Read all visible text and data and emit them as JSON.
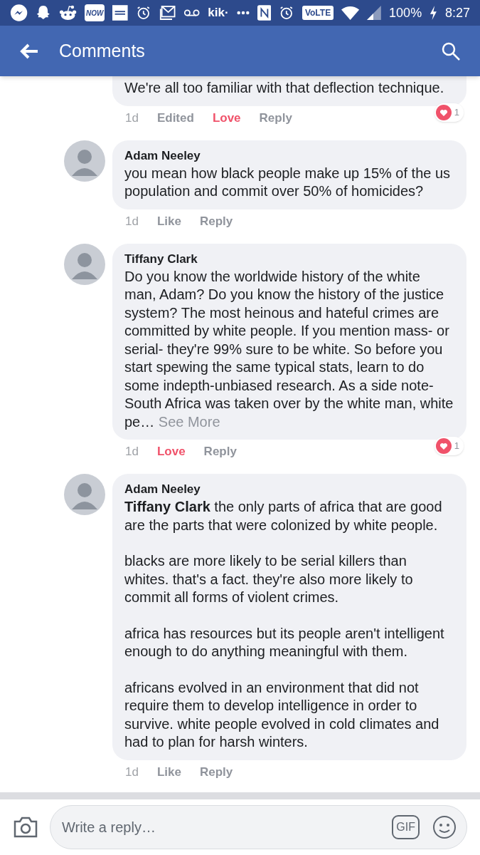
{
  "status_bar": {
    "badges": [
      "NOW",
      "kik·",
      "VoLTE"
    ],
    "battery": "100%",
    "time": "8:27"
  },
  "header": {
    "title": "Comments"
  },
  "comments": [
    {
      "cut_top": true,
      "paragraphs": [
        "We're all too familiar with that deflection technique."
      ],
      "time": "1d",
      "actions": [
        {
          "label": "Edited",
          "active": false
        },
        {
          "label": "Love",
          "active": true
        },
        {
          "label": "Reply",
          "active": false
        }
      ],
      "reactions": {
        "count": "1"
      }
    },
    {
      "author": "Adam Neeley",
      "paragraphs": [
        "you mean how black people make up 15% of the us population and commit over 50% of homicides?"
      ],
      "time": "1d",
      "actions": [
        {
          "label": "Like",
          "active": false
        },
        {
          "label": "Reply",
          "active": false
        }
      ]
    },
    {
      "author": "Tiffany Clark",
      "paragraphs": [
        "Do you know the worldwide history of the white man, Adam? Do you know the history of the justice system? The most heinous and hateful crimes are committed by white people. If you mention mass- or serial- they're 99% sure to be white. So before you start spewing the same typical stats, learn to do some indepth-unbiased research. As a side note- South Africa was taken over by the white man, white pe…"
      ],
      "see_more": "See More",
      "time": "1d",
      "actions": [
        {
          "label": "Love",
          "active": true
        },
        {
          "label": "Reply",
          "active": false
        }
      ],
      "reactions": {
        "count": "1"
      }
    },
    {
      "author": "Adam Neeley",
      "paragraphs": [
        "**Tiffany Clark** the only parts of africa that are good are the parts that were colonized by white people.",
        "blacks are more likely to be serial killers than whites. that's a fact. they're also more likely to commit all forms of violent crimes.",
        "africa has resources but its people aren't intelligent enough to do anything meaningful with them.",
        "africans evolved in an environment that did not require them to develop intelligence in order to survive. white people evolved in cold climates and had to plan for harsh winters."
      ],
      "time": "1d",
      "actions": [
        {
          "label": "Like",
          "active": false
        },
        {
          "label": "Reply",
          "active": false
        }
      ]
    }
  ],
  "composer": {
    "placeholder": "Write a reply…",
    "gif": "GIF"
  }
}
